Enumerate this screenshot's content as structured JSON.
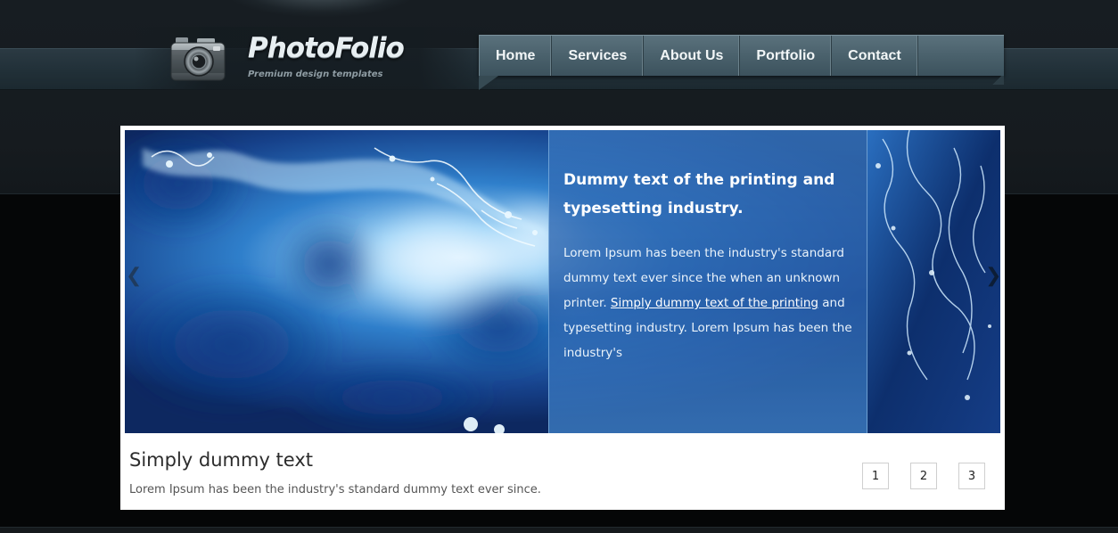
{
  "header": {
    "brand": "PhotoFolio",
    "tagline": "Premium design templates",
    "logo_icon": "camera-icon"
  },
  "nav": {
    "items": [
      {
        "label": "Home"
      },
      {
        "label": "Services"
      },
      {
        "label": "About Us"
      },
      {
        "label": "Portfolio"
      },
      {
        "label": "Contact"
      }
    ]
  },
  "slider": {
    "caption": {
      "title": "Dummy text of the printing and typesetting industry.",
      "body_before": "Lorem Ipsum has been the industry's standard dummy text ever since the when an unknown printer. ",
      "link": "Simply dummy text of the printing",
      "body_after": " and typesetting industry. Lorem Ipsum has been the industry's"
    },
    "prev_arrow": "❮",
    "next_arrow": "❯",
    "title": "Simply dummy text",
    "description": "Lorem Ipsum has been the industry's standard dummy text ever since.",
    "pages": [
      "1",
      "2",
      "3"
    ]
  },
  "colors": {
    "header_bg": "#171d22",
    "nav_bg": "#4a616c",
    "caption_bg": "#2f66b0",
    "frame": "#ffffff"
  }
}
